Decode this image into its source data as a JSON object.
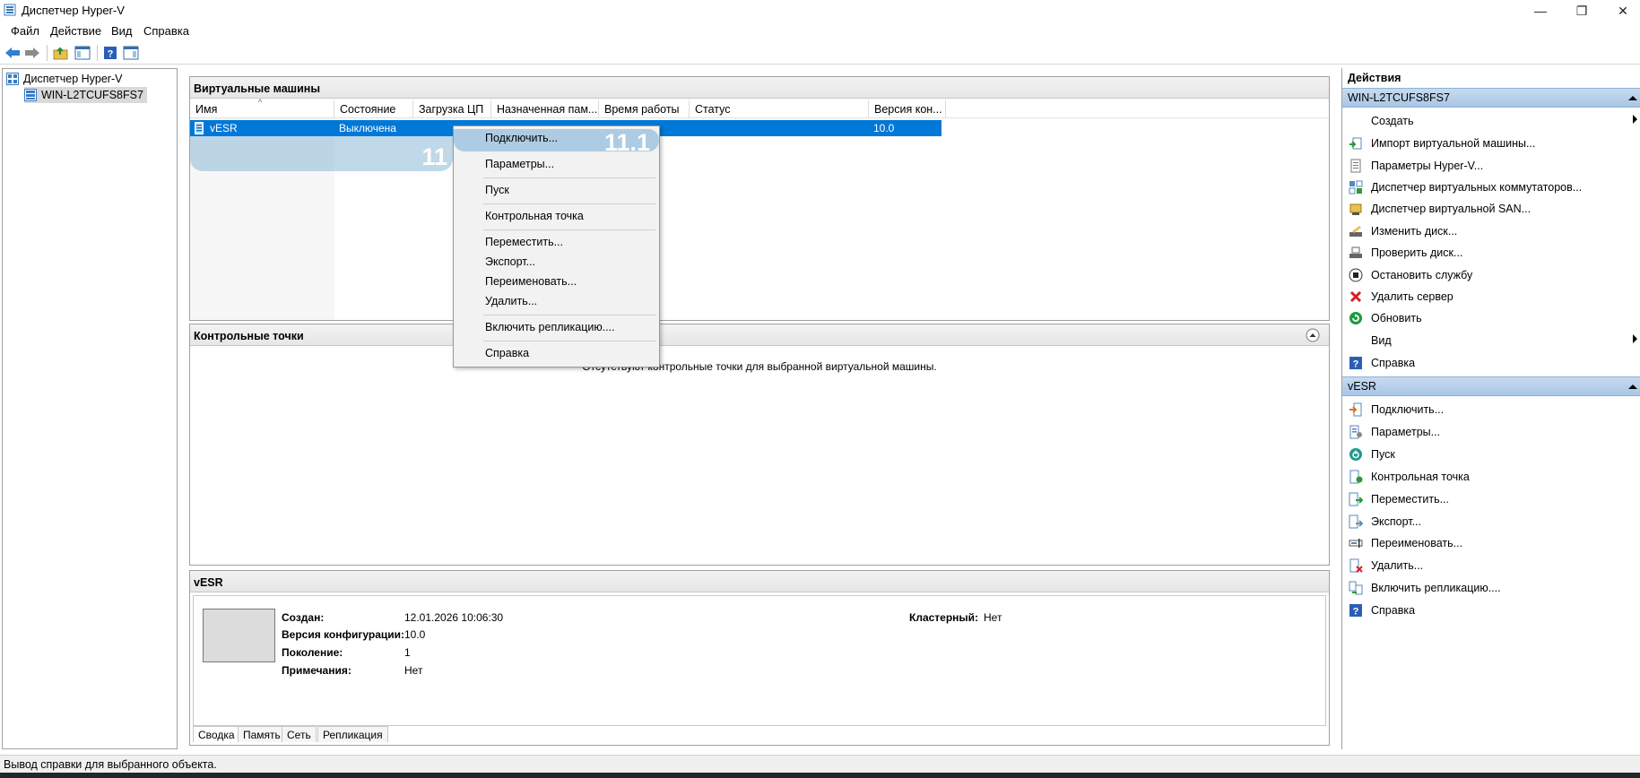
{
  "window": {
    "title": "Диспетчер Hyper-V",
    "minimize": "—",
    "maximize": "❐",
    "close": "✕"
  },
  "menu": [
    "Файл",
    "Действие",
    "Вид",
    "Справка"
  ],
  "tree": {
    "root": "Диспетчер Hyper-V",
    "server": "WIN-L2TCUFS8FS7"
  },
  "vms_panel": {
    "title": "Виртуальные машины",
    "columns": [
      "Имя",
      "Состояние",
      "Загрузка ЦП",
      "Назначенная пам...",
      "Время работы",
      "Статус",
      "Версия кон..."
    ],
    "rows": [
      {
        "name": "vESR",
        "state": "Выключена",
        "version": "10.0"
      }
    ],
    "overlay_left": "11",
    "overlay_menu": "11.1"
  },
  "context_menu": [
    "Подключить...",
    "Параметры...",
    "Пуск",
    "Контрольная точка",
    "Переместить...",
    "Экспорт...",
    "Переименовать...",
    "Удалить...",
    "Включить репликацию....",
    "Справка"
  ],
  "checkpoints_panel": {
    "title": "Контрольные точки",
    "empty": "Отсутствуют контрольные точки для выбранной виртуальной машины."
  },
  "details_panel": {
    "title": "vESR",
    "fields": [
      {
        "label": "Создан:",
        "value": "12.01.2026 10:06:30"
      },
      {
        "label": "Версия конфигурации:",
        "value": "10.0"
      },
      {
        "label": "Поколение:",
        "value": "1"
      },
      {
        "label": "Примечания:",
        "value": "Нет"
      }
    ],
    "cluster_label": "Кластерный:",
    "cluster_value": "Нет",
    "tabs": [
      "Сводка",
      "Память",
      "Сеть",
      "Репликация"
    ]
  },
  "actions": {
    "title": "Действия",
    "server_section": "WIN-L2TCUFS8FS7",
    "server_items": [
      "Создать",
      "Импорт виртуальной машины...",
      "Параметры Hyper-V...",
      "Диспетчер виртуальных коммутаторов...",
      "Диспетчер виртуальной SAN...",
      "Изменить диск...",
      "Проверить диск...",
      "Остановить службу",
      "Удалить сервер",
      "Обновить",
      "Вид",
      "Справка"
    ],
    "vm_section": "vESR",
    "vm_items": [
      "Подключить...",
      "Параметры...",
      "Пуск",
      "Контрольная точка",
      "Переместить...",
      "Экспорт...",
      "Переименовать...",
      "Удалить...",
      "Включить репликацию....",
      "Справка"
    ]
  },
  "status": "Вывод справки для выбранного объекта.",
  "colors": {
    "selection": "#0078d7",
    "section_header": "#b8d1ea",
    "menu_highlight": "#bfd7ea",
    "overlay": "#9cc3dc"
  }
}
